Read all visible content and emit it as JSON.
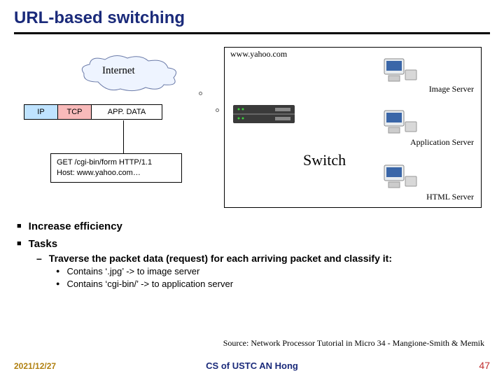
{
  "title": "URL-based switching",
  "diagram": {
    "cloud_label": "Internet",
    "packet": {
      "ip": "IP",
      "tcp": "TCP",
      "app": "APP. DATA"
    },
    "http_request": {
      "line1": "GET /cgi-bin/form HTTP/1.1",
      "line2": "Host: www.yahoo.com…"
    },
    "cluster_host": "www.yahoo.com",
    "switch_label": "Switch",
    "servers": {
      "image": "Image Server",
      "application": "Application Server",
      "html": "HTML Server"
    }
  },
  "bullets": {
    "b1a": "Increase efficiency",
    "b1b": "Tasks",
    "b2": "Traverse the packet data (request) for each arriving packet and classify it:",
    "b3a": "Contains ‘.jpg’ -> to image server",
    "b3b": "Contains ‘cgi-bin/’ -> to application server"
  },
  "source": "Source: Network Processor Tutorial in Micro 34 - Mangione-Smith & Memik",
  "footer": {
    "date": "2021/12/27",
    "center": "CS of USTC AN Hong",
    "page": "47"
  }
}
